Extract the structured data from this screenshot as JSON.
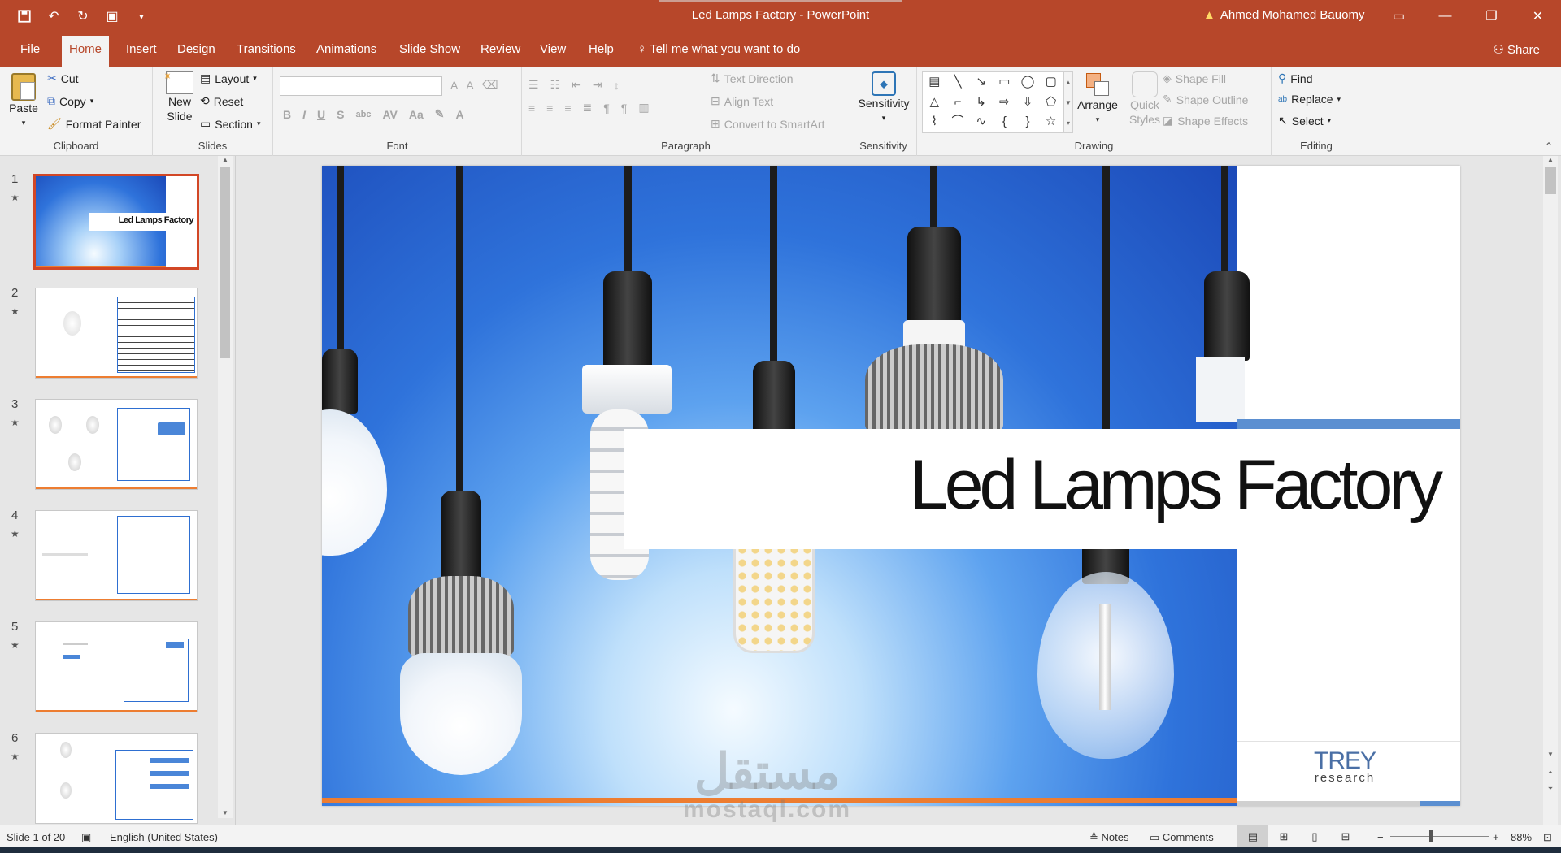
{
  "window": {
    "title": "Led Lamps Factory  -  PowerPoint",
    "user": "Ahmed Mohamed Bauomy"
  },
  "tabs": [
    "File",
    "Home",
    "Insert",
    "Design",
    "Transitions",
    "Animations",
    "Slide Show",
    "Review",
    "View",
    "Help"
  ],
  "tell_me": "Tell me what you want to do",
  "share": "Share",
  "ribbon": {
    "clipboard": {
      "paste": "Paste",
      "cut": "Cut",
      "copy": "Copy",
      "format_painter": "Format Painter",
      "label": "Clipboard"
    },
    "slides": {
      "new_slide_1": "New",
      "new_slide_2": "Slide",
      "layout": "Layout",
      "reset": "Reset",
      "section": "Section",
      "label": "Slides"
    },
    "font": {
      "label": "Font"
    },
    "paragraph": {
      "text_direction": "Text Direction",
      "align_text": "Align Text",
      "convert": "Convert to SmartArt",
      "label": "Paragraph"
    },
    "sensitivity": {
      "button": "Sensitivity",
      "label": "Sensitivity"
    },
    "drawing": {
      "arrange": "Arrange",
      "quick_1": "Quick",
      "quick_2": "Styles",
      "shape_fill": "Shape Fill",
      "shape_outline": "Shape Outline",
      "shape_effects": "Shape Effects",
      "label": "Drawing"
    },
    "editing": {
      "find": "Find",
      "replace": "Replace",
      "select": "Select",
      "label": "Editing"
    }
  },
  "thumbnails": [
    {
      "num": "1",
      "title": "Led Lamps Factory"
    },
    {
      "num": "2"
    },
    {
      "num": "3"
    },
    {
      "num": "4"
    },
    {
      "num": "5"
    },
    {
      "num": "6"
    }
  ],
  "slide": {
    "title": "Led Lamps Factory",
    "logo_1": "TREY",
    "logo_2": "research"
  },
  "watermark": {
    "ar": "مستقل",
    "en": "mostaql.com"
  },
  "status": {
    "slide_of": "Slide 1 of 20",
    "language": "English (United States)",
    "notes": "Notes",
    "comments": "Comments",
    "zoom": "88%"
  },
  "colors": {
    "accent": "#b7472a",
    "ribbon_bg": "#f3f3f3",
    "slide_blue": "#2f73db"
  }
}
